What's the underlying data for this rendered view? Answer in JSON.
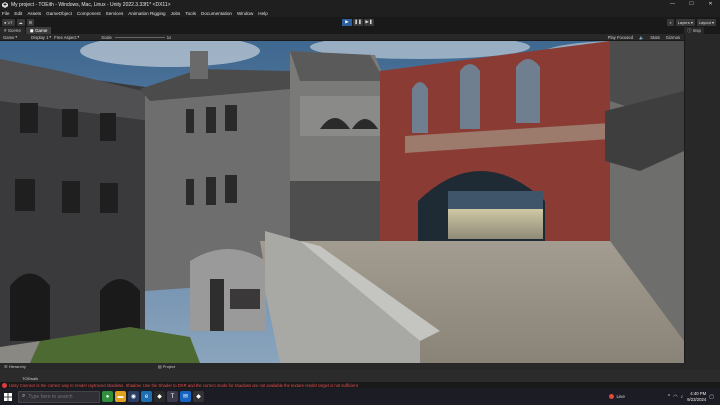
{
  "window": {
    "title": "My project - TOEith - Windows, Mac, Linux - Unity 2022.3.33f1* <DX11>",
    "minimize": "—",
    "maximize": "☐",
    "close": "✕"
  },
  "menu": [
    "File",
    "Edit",
    "Assets",
    "GameObject",
    "Component",
    "Services",
    "Animation Rigging",
    "Jobs",
    "Tools",
    "Documentation",
    "Window",
    "Help"
  ],
  "toolbar": {
    "account": "VT",
    "play": "▶",
    "pause": "❚❚",
    "step": "▶❚",
    "layers": "Layers",
    "layout": "Layout"
  },
  "tabs": {
    "scene": "Scene",
    "game": "Game",
    "inspector": "Insp"
  },
  "gamebar": {
    "mode": "Game",
    "display": "Display 1",
    "aspect": "Free Aspect",
    "scale_label": "Scale",
    "scale_value": "1x",
    "play_focused": "Play Focused",
    "stats": "Stats",
    "gizmos": "Gizmos"
  },
  "bottom": {
    "hierarchy": "Hierarchy",
    "project": "Project",
    "hierarchy_item": "TOEwalk"
  },
  "status": {
    "error": "Unity Connect is the correct way to render raytraced shadows. Shadow. Use the Shader to DXR and the correct mode for shadows are not available the texture render target is not sufficient"
  },
  "taskbar": {
    "search_placeholder": "Type here to search",
    "live": "Live",
    "time": "4:40 PM",
    "date": "9/23/2024"
  },
  "colors": {
    "accent": "#2d5f9e",
    "error": "#e35050"
  }
}
